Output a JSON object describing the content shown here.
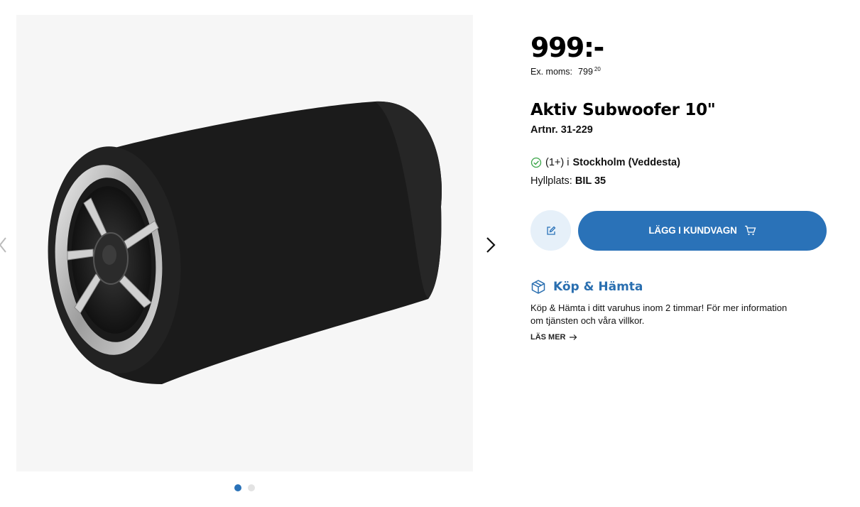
{
  "gallery": {
    "image_alt": "Aktiv Subwoofer 10\"",
    "image_count": 2,
    "active_index": 0
  },
  "product": {
    "price": "999:-",
    "ex_moms_label": "Ex. moms:",
    "ex_moms_main": "799",
    "ex_moms_cents": "20",
    "title": "Aktiv Subwoofer 10\"",
    "artnr": "Artnr. 31-229"
  },
  "stock": {
    "count": "(1+) i",
    "store": "Stockholm (Veddesta)",
    "shelf_label": "Hyllplats:",
    "shelf_value": "BIL 35"
  },
  "actions": {
    "add_to_cart_label": "LÄGG I KUNDVAGN"
  },
  "kop_hamta": {
    "title": "Köp & Hämta",
    "description": "Köp & Hämta i ditt varuhus inom 2 timmar! För mer information om tjänsten och våra villkor.",
    "read_more": "LÄS MER"
  },
  "colors": {
    "accent": "#2a72b8",
    "accent_light": "#e6f0f9",
    "stock_ok": "#3aa548"
  }
}
